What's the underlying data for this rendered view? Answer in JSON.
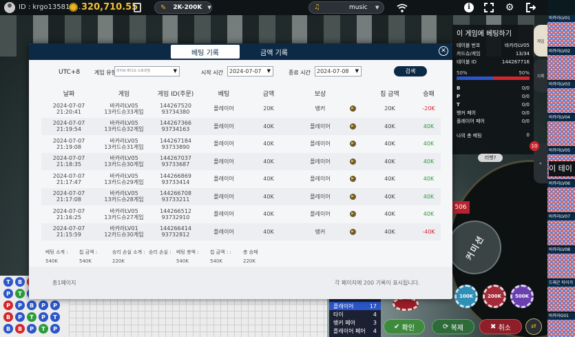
{
  "topbar": {
    "user_id": "ID : krgo135817...",
    "balance": "320,710.55",
    "bet_limit": "2K-200K",
    "music_label": "music"
  },
  "info_panel": {
    "title": "이 게임에 베팅하기",
    "rows": [
      {
        "k": "테이블 번호",
        "v": "바카라LV05"
      },
      {
        "k": "카드슈/게임",
        "v": "13/34"
      },
      {
        "k": "테이블 ID",
        "v": "144267716"
      }
    ],
    "pct_left": "50%",
    "pct_right": "50%",
    "stats": [
      {
        "k": "B",
        "v": "0/0"
      },
      {
        "k": "P",
        "v": "0/0"
      },
      {
        "k": "T",
        "v": "0/0"
      },
      {
        "k": "뱅커 페어",
        "v": "0/0"
      },
      {
        "k": "플레이어 페어",
        "v": "0/0"
      }
    ],
    "total_label": "나의 총 베팅",
    "total_value": "0",
    "rebet": "리벳?"
  },
  "side_tables": [
    "바카라LV01",
    "바카라LV02",
    "바카라LV03",
    "바카라LV04",
    "바카라LV05",
    "바카라LV06",
    "바카라LV07",
    "바카라LV08",
    "드래곤 타이거",
    "바카라G01"
  ],
  "side_tab_label": "게임",
  "side_tab_label2": "기록",
  "side_big_text": "이 테이",
  "badge_count": "10",
  "red_tag": "506",
  "commission": "커미션",
  "modal": {
    "tab_bets": "베팅 기록",
    "tab_amount": "금액 기록",
    "close": "✕",
    "filter": {
      "timezone": "UTC+8",
      "game_type_label": "게임 유형",
      "game_type_value": "리아브 바디오 스트리밍",
      "start_label": "시작 시간",
      "start_value": "2024-07-07",
      "end_label": "종료 시간",
      "end_value": "2024-07-08",
      "search": "검색"
    },
    "columns": [
      "날짜",
      "게임",
      "게임 ID(주문)",
      "베팅",
      "금액",
      "보상",
      "칩 금액",
      "승패"
    ],
    "rows": [
      {
        "date": "2024-07-07",
        "time": "21:20:41",
        "game": "바카라LV05",
        "shoe": "13카드슈33게임",
        "gid": "144267520",
        "order": "93734380",
        "bet": "플레이어",
        "amount": "20K",
        "reward": "뱅커",
        "chip": "20K",
        "result": "-20K",
        "win": false
      },
      {
        "date": "2024-07-07",
        "time": "21:19:54",
        "game": "바카라LV05",
        "shoe": "13카드슈32게임",
        "gid": "144267366",
        "order": "93734163",
        "bet": "플레이어",
        "amount": "40K",
        "reward": "플레이어",
        "chip": "40K",
        "result": "40K",
        "win": true
      },
      {
        "date": "2024-07-07",
        "time": "21:19:08",
        "game": "바카라LV05",
        "shoe": "13카드슈31게임",
        "gid": "144267184",
        "order": "93733890",
        "bet": "플레이어",
        "amount": "40K",
        "reward": "플레이어",
        "chip": "40K",
        "result": "40K",
        "win": true
      },
      {
        "date": "2024-07-07",
        "time": "21:18:35",
        "game": "바카라LV05",
        "shoe": "13카드슈30게임",
        "gid": "144267037",
        "order": "93733687",
        "bet": "플레이어",
        "amount": "40K",
        "reward": "플레이어",
        "chip": "40K",
        "result": "40K",
        "win": true
      },
      {
        "date": "2024-07-07",
        "time": "21:17:47",
        "game": "바카라LV05",
        "shoe": "13카드슈29게임",
        "gid": "144266869",
        "order": "93733414",
        "bet": "플레이어",
        "amount": "40K",
        "reward": "플레이어",
        "chip": "40K",
        "result": "40K",
        "win": true
      },
      {
        "date": "2024-07-07",
        "time": "21:17:08",
        "game": "바카라LV05",
        "shoe": "13카드슈28게임",
        "gid": "144266708",
        "order": "93733211",
        "bet": "플레이어",
        "amount": "40K",
        "reward": "플레이어",
        "chip": "40K",
        "result": "40K",
        "win": true
      },
      {
        "date": "2024-07-07",
        "time": "21:16:25",
        "game": "바카라LV05",
        "shoe": "13카드슈27게임",
        "gid": "144266512",
        "order": "93732910",
        "bet": "플레이어",
        "amount": "40K",
        "reward": "플레이어",
        "chip": "40K",
        "result": "40K",
        "win": true
      },
      {
        "date": "2024-07-07",
        "time": "21:15:59",
        "game": "바카라LV01",
        "shoe": "12카드슈30게임",
        "gid": "144266414",
        "order": "93732812",
        "bet": "플레이어",
        "amount": "40K",
        "reward": "뱅커",
        "chip": "40K",
        "result": "-40K",
        "win": false
      }
    ],
    "summary": [
      {
        "label": "베팅 소계 :",
        "value": "540K"
      },
      {
        "label": "칩 금액 :",
        "value": "540K"
      },
      {
        "label": "승리 손실 소계 :",
        "value": "220K"
      },
      {
        "label": "승리 손실 :",
        "value": ""
      },
      {
        "label": "베팅 총액 :",
        "value": "540K"
      },
      {
        "label": "칩 금액 : :",
        "value": "540K"
      },
      {
        "label": "총 승패",
        "value": "220K"
      }
    ],
    "pages": "총1페이지",
    "records": "각 페이지에 200 기록이 표시됩니다."
  },
  "bottom_stats": [
    {
      "k": "플레이어",
      "v": "17"
    },
    {
      "k": "타이",
      "v": "4"
    },
    {
      "k": "뱅커 페어",
      "v": "3"
    },
    {
      "k": "플레이어 페어",
      "v": "4"
    }
  ],
  "chips": [
    "100K",
    "200K",
    "500K"
  ],
  "buttons": {
    "confirm": "확인",
    "repeat": "복제",
    "cancel": "취소"
  },
  "colors": {
    "navy": "#0c2a46",
    "win": "#2a9e35",
    "lose": "#d3262c",
    "gold": "#f2c038"
  }
}
